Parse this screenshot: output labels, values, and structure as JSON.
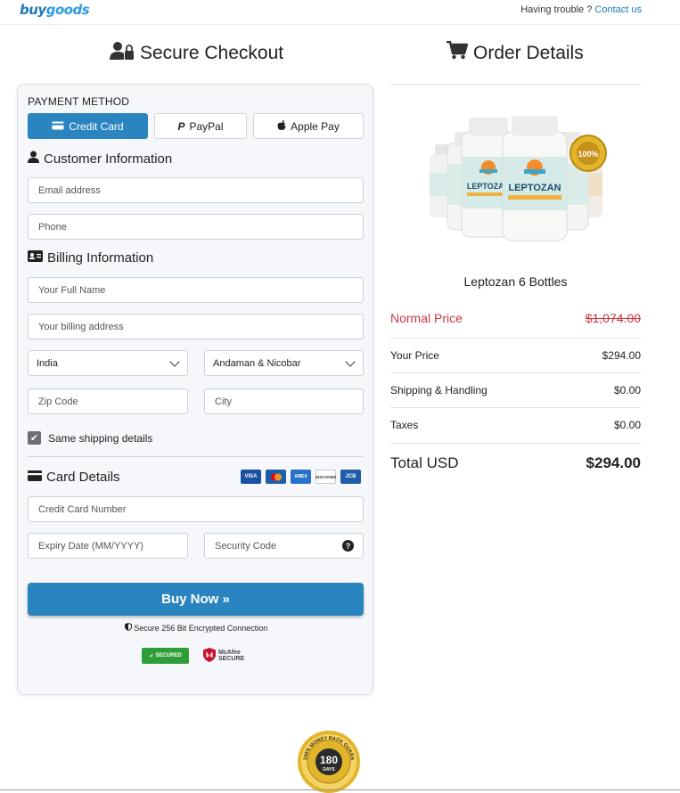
{
  "brand": {
    "logo_text_main": "buy",
    "logo_text_accent": "goods"
  },
  "topbar": {
    "help_prefix": "Having trouble ?",
    "help_link": "Contact us"
  },
  "checkout": {
    "title": "Secure Checkout",
    "payment_method_label": "PAYMENT METHOD",
    "payment_methods": [
      {
        "label": "Credit Card",
        "icon": "credit-card-icon",
        "active": true
      },
      {
        "label": "PayPal",
        "icon": "paypal-icon",
        "active": false
      },
      {
        "label": "Apple Pay",
        "icon": "apple-icon",
        "active": false
      }
    ],
    "customer_info": {
      "title": "Customer Information",
      "email_placeholder": "Email address",
      "phone_placeholder": "Phone"
    },
    "billing_info": {
      "title": "Billing Information",
      "full_name_placeholder": "Your Full Name",
      "address_placeholder": "Your billing address",
      "country_value": "India",
      "state_value": "Andaman & Nicobar",
      "zip_placeholder": "Zip Code",
      "city_placeholder": "City"
    },
    "same_shipping_label": "Same shipping details",
    "same_shipping_checked": true,
    "card_details": {
      "title": "Card Details",
      "accepted_cards": [
        "VISA",
        "Mastercard",
        "AMEX",
        "DISCOVER",
        "JCB"
      ],
      "card_number_placeholder": "Credit Card Number",
      "expiry_placeholder": "Expiry Date (MM/YYYY)",
      "security_code_placeholder": "Security Code"
    },
    "buy_button_label": "Buy Now »",
    "secure_text": "Secure 256 Bit Encrypted Connection",
    "seals": {
      "secured_label": "SECURED",
      "mcafee_line1": "McAfee",
      "mcafee_line2": "SECURE"
    }
  },
  "order": {
    "title": "Order Details",
    "product_name": "Leptozan 6 Bottles",
    "product_label_text": "LEPTOZAN",
    "normal_price_label": "Normal Price",
    "normal_price_value": "$1,074.00",
    "your_price_label": "Your Price",
    "your_price_value": "$294.00",
    "shipping_label": "Shipping & Handling",
    "shipping_value": "$0.00",
    "taxes_label": "Taxes",
    "taxes_value": "$0.00",
    "total_label": "Total USD",
    "total_value": "$294.00"
  },
  "guarantee": {
    "days": "180",
    "days_label": "DAYS",
    "ring_text": "100% MONEY BACK GUARANTEE"
  },
  "colors": {
    "primary": "#2a84bf",
    "normal_price": "#c9383f",
    "card_bg": "#f5f7fa",
    "gold": "#e2b52a"
  }
}
